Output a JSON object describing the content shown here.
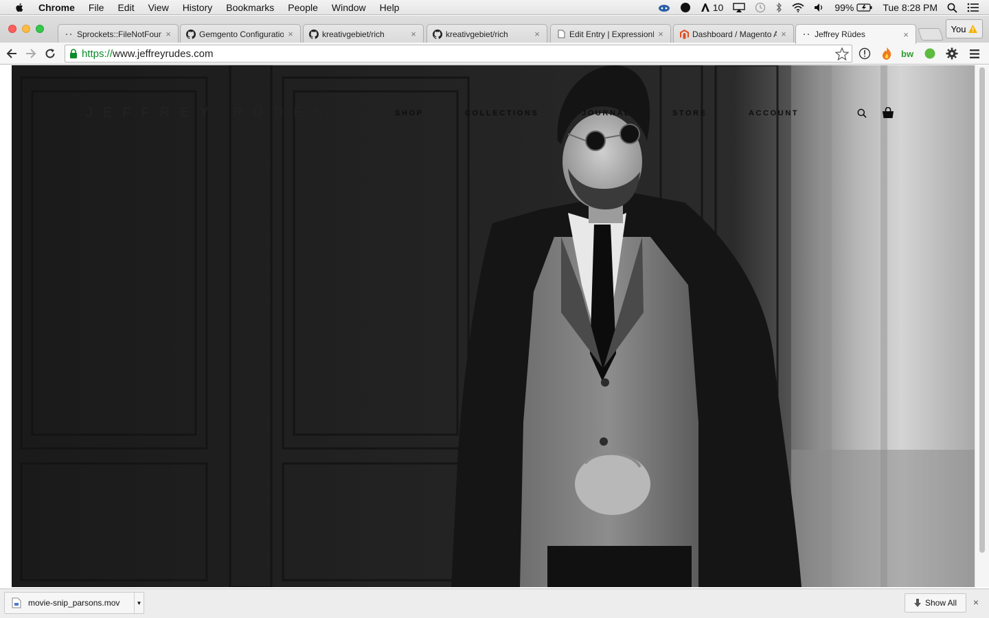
{
  "menubar": {
    "app_name": "Chrome",
    "items": [
      "File",
      "Edit",
      "View",
      "History",
      "Bookmarks",
      "People",
      "Window",
      "Help"
    ],
    "status": {
      "notification_count": "10",
      "battery": "99%",
      "clock": "Tue 8:28 PM"
    }
  },
  "tabs": [
    {
      "title": "Sprockets::FileNotFoun",
      "icon": "dots-icon",
      "active": false
    },
    {
      "title": "Gemgento Configuratio",
      "icon": "github-icon",
      "active": false
    },
    {
      "title": "kreativgebiet/rich",
      "icon": "github-icon",
      "active": false
    },
    {
      "title": "kreativgebiet/rich",
      "icon": "github-icon",
      "active": false
    },
    {
      "title": "Edit Entry | ExpressionE",
      "icon": "document-icon",
      "active": false
    },
    {
      "title": "Dashboard / Magento A",
      "icon": "magento-icon",
      "active": false
    },
    {
      "title": "Jeffrey Rüdes",
      "icon": "dots-icon",
      "active": true
    }
  ],
  "profile_button": {
    "label": "You",
    "icon": "warning-icon"
  },
  "toolbar": {
    "url_scheme": "https://",
    "url_host": "www.jeffreyrudes.com"
  },
  "page": {
    "logo": "JEFFREY RÜDES",
    "nav": [
      "SHOP",
      "COLLECTIONS",
      "JOURNAL",
      "STORE",
      "ACCOUNT"
    ],
    "hero_description": "Black and white portrait photograph"
  },
  "downloads": {
    "items": [
      {
        "filename": "movie-snip_parsons.mov"
      }
    ],
    "show_all_label": "Show All"
  },
  "colors": {
    "secure_green": "#0a8a2b",
    "close": "#fc605c",
    "minimize": "#fdbc40",
    "zoom": "#34c84a"
  }
}
